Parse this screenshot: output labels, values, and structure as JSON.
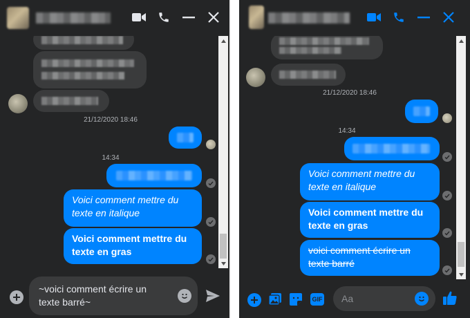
{
  "colors": {
    "background": "#242526",
    "bubble_incoming": "#3a3b3c",
    "bubble_outgoing": "#0084ff",
    "icon_left": "#e4e6eb",
    "icon_right": "#0084ff",
    "text_muted": "#b0b3b8"
  },
  "left_window": {
    "header_icons": [
      "video-camera-icon",
      "phone-icon",
      "minimize-icon",
      "close-icon"
    ],
    "timestamp_1": "21/12/2020 18:46",
    "timestamp_2": "14:34",
    "messages": [
      {
        "text": "Voici comment mettre du texte en italique",
        "style": "italic"
      },
      {
        "text": "Voici comment mettre du texte en gras",
        "style": "bold"
      }
    ],
    "composer_text": "~voici comment écrire un texte barré~",
    "composer_icons": [
      "plus-circle-icon",
      "emoji-icon",
      "send-icon"
    ]
  },
  "right_window": {
    "header_icons": [
      "video-camera-icon",
      "phone-icon",
      "minimize-icon",
      "close-icon"
    ],
    "timestamp_1": "21/12/2020 18:46",
    "timestamp_2": "14:34",
    "messages": [
      {
        "text": "Voici comment mettre du texte en italique",
        "style": "italic"
      },
      {
        "text": "Voici comment mettre du texte en gras",
        "style": "bold"
      },
      {
        "text": "voici comment écrire un texte barré",
        "style": "strikethrough"
      }
    ],
    "composer_placeholder": "Aa",
    "gif_label": "GIF",
    "composer_icons": [
      "plus-circle-icon",
      "photo-icon",
      "sticker-icon",
      "gif-icon",
      "emoji-icon",
      "thumbs-up-icon"
    ]
  }
}
